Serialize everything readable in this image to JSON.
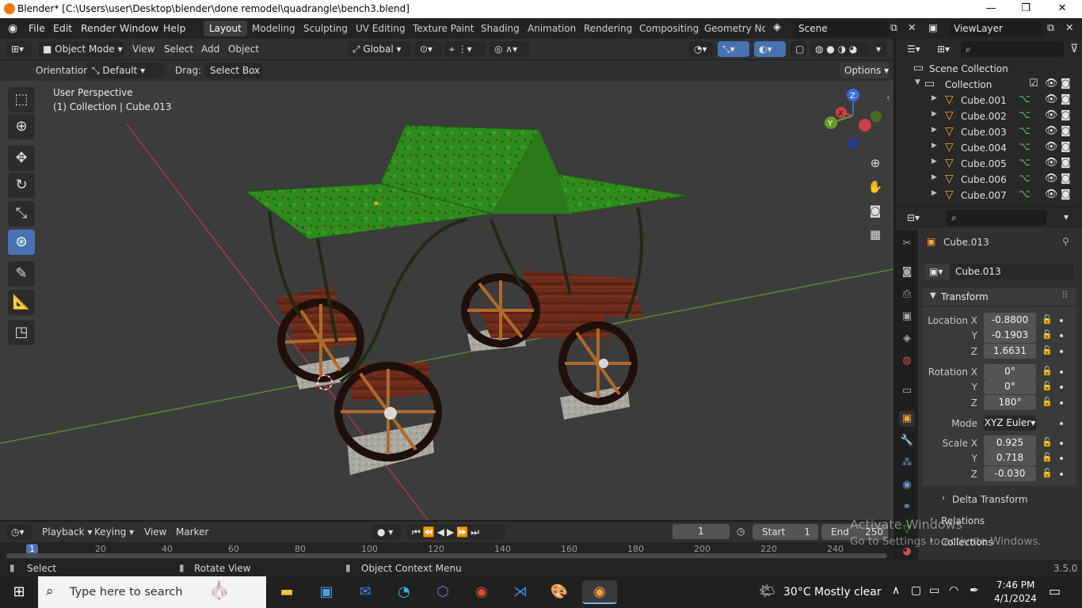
{
  "window": {
    "title": "Blender* [C:\\Users\\user\\Desktop\\blender\\done remodel\\quadrangle\\bench3.blend]",
    "minimize": "—",
    "maximize": "❐",
    "close": "✕"
  },
  "menu": {
    "file": "File",
    "edit": "Edit",
    "render": "Render",
    "window": "Window",
    "help": "Help"
  },
  "workspaces": [
    "Layout",
    "Modeling",
    "Sculpting",
    "UV Editing",
    "Texture Paint",
    "Shading",
    "Animation",
    "Rendering",
    "Compositing",
    "Geometry Noc"
  ],
  "scene": {
    "name": "Scene",
    "view_layer": "ViewLayer"
  },
  "viewport_header": {
    "mode": "Object Mode",
    "view": "View",
    "select": "Select",
    "add": "Add",
    "object": "Object",
    "transform_orientation": "Global"
  },
  "tool_settings": {
    "orientation_label": "Orientation:",
    "orientation_value": "Default",
    "drag_label": "Drag:",
    "drag_value": "Select Box",
    "options": "Options"
  },
  "viewport": {
    "perspective": "User Perspective",
    "active": "(1) Collection | Cube.013"
  },
  "gizmo": {
    "z": "Z",
    "y": "Y",
    "x": "X"
  },
  "outliner": {
    "scene_collection": "Scene Collection",
    "collection": "Collection",
    "items": [
      "Cube.001",
      "Cube.002",
      "Cube.003",
      "Cube.004",
      "Cube.005",
      "Cube.006",
      "Cube.007"
    ]
  },
  "properties": {
    "object_name": "Cube.013",
    "datablock": "Cube.013",
    "transform": "Transform",
    "location_x_label": "Location X",
    "location_x": "-0.8800",
    "location_y": "-0.1903",
    "location_z": "1.6631",
    "rotation_x_label": "Rotation X",
    "rotation_x": "0°",
    "rotation_y": "0°",
    "rotation_z": "180°",
    "mode_label": "Mode",
    "mode": "XYZ Euler",
    "scale_x_label": "Scale X",
    "scale_x": "0.925",
    "scale_y": "0.718",
    "scale_z": "-0.030",
    "y_label": "Y",
    "z_label": "Z",
    "delta_transform": "Delta Transform",
    "relations": "Relations",
    "collections": "Collections"
  },
  "timeline": {
    "playback": "Playback",
    "keying": "Keying",
    "view": "View",
    "marker": "Marker",
    "current_frame": "1",
    "start_label": "Start",
    "start": "1",
    "end_label": "End",
    "end": "250",
    "ticks": [
      "1",
      "20",
      "40",
      "60",
      "80",
      "100",
      "120",
      "140",
      "160",
      "180",
      "200",
      "220",
      "240"
    ]
  },
  "statusbar": {
    "select": "Select",
    "rotate": "Rotate View",
    "context": "Object Context Menu",
    "version": "3.5.0"
  },
  "watermark": {
    "line1": "Activate Windows",
    "line2": "Go to Settings to activate Windows."
  },
  "taskbar": {
    "search_placeholder": "Type here to search",
    "weather": "30°C  Mostly clear",
    "time": "7:46 PM",
    "date": "4/1/2024"
  },
  "colors": {
    "accent": "#4772b3",
    "active_orange": "#ff9e3d",
    "x_axis": "#c8404a",
    "y_axis": "#6a9a2a"
  }
}
